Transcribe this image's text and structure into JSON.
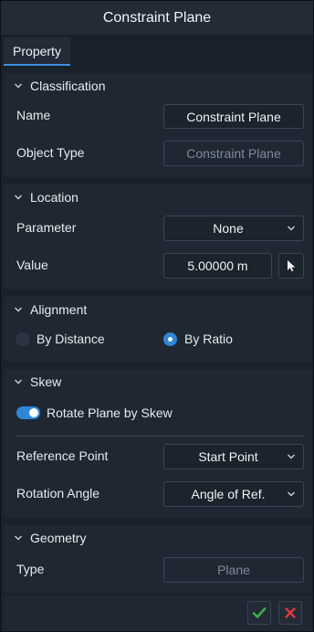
{
  "window": {
    "title": "Constraint Plane"
  },
  "tabs": [
    {
      "label": "Property",
      "active": true
    }
  ],
  "classification": {
    "header": "Classification",
    "name_label": "Name",
    "name_value": "Constraint Plane",
    "object_type_label": "Object Type",
    "object_type_value": "Constraint Plane"
  },
  "location": {
    "header": "Location",
    "parameter_label": "Parameter",
    "parameter_value": "None",
    "value_label": "Value",
    "value_value": "5.00000 m"
  },
  "alignment": {
    "header": "Alignment",
    "options": [
      {
        "label": "By Distance",
        "selected": false
      },
      {
        "label": "By Ratio",
        "selected": true
      }
    ]
  },
  "skew": {
    "header": "Skew",
    "toggle_label": "Rotate Plane by Skew",
    "toggle_on": true,
    "reference_point_label": "Reference Point",
    "reference_point_value": "Start Point",
    "rotation_angle_label": "Rotation Angle",
    "rotation_angle_value": "Angle of Ref."
  },
  "geometry": {
    "header": "Geometry",
    "type_label": "Type",
    "type_value": "Plane"
  },
  "colors": {
    "accent": "#2f86d8",
    "confirm": "#3fae4a",
    "cancel": "#e0393e",
    "background": "#19212b",
    "section": "#1f2832"
  }
}
